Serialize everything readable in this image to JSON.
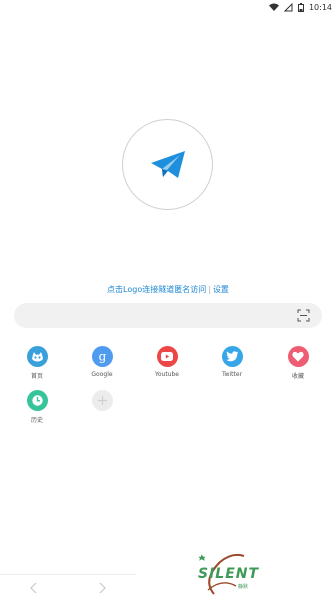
{
  "status_bar": {
    "time": "10:14",
    "battery_text": "1"
  },
  "hint": {
    "text": "点击Logo连接隧道匿名访问",
    "separator": "|",
    "settings_label": "设置"
  },
  "search": {
    "value": "",
    "placeholder": ""
  },
  "shortcuts": [
    {
      "label": "首页",
      "icon": "home-icon",
      "color": "#3aa0dc"
    },
    {
      "label": "Google",
      "icon": "google-g-icon",
      "color": "#4f9bf0"
    },
    {
      "label": "Youtube",
      "icon": "youtube-play-icon",
      "color": "#ec4646"
    },
    {
      "label": "Twitter",
      "icon": "twitter-bird-icon",
      "color": "#37a6e8"
    },
    {
      "label": "收藏",
      "icon": "heart-icon",
      "color": "#ef5d73"
    },
    {
      "label": "历史",
      "icon": "clock-icon",
      "color": "#38c49a"
    },
    {
      "label": "",
      "icon": "add-icon",
      "color": "#ececec"
    }
  ],
  "watermark": {
    "brand": "SILENT",
    "sub": "静默"
  },
  "colors": {
    "accent": "#1a85d6",
    "logo_plane": "#1e8fdc"
  }
}
